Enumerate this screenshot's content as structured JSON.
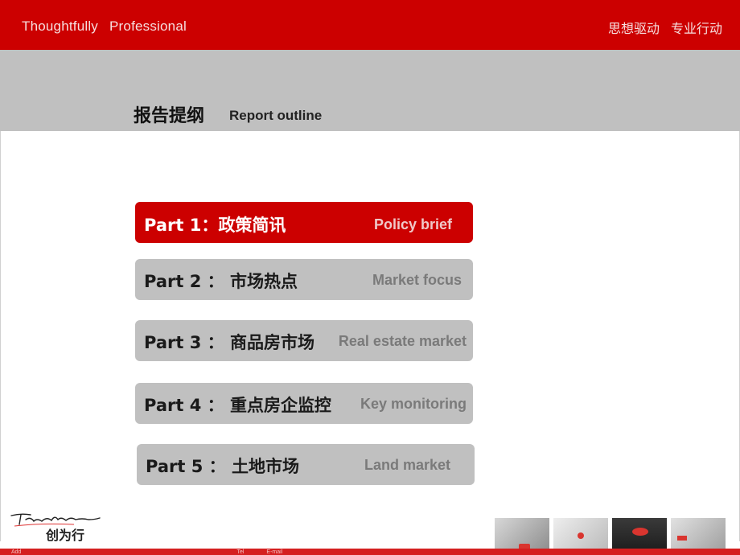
{
  "header": {
    "slogan_en": [
      "Thoughtfully",
      "Professional"
    ],
    "slogan_cn": [
      "思想驱动",
      "专业行动"
    ]
  },
  "section": {
    "title_cn": "报告提纲",
    "title_en": "Report outline"
  },
  "outline": [
    {
      "label_cn": "Part 1：政策简讯",
      "label_en": "Policy brief",
      "active": true
    },
    {
      "label_cn": "Part 2 ： 市场热点",
      "label_en": "Market focus",
      "active": false
    },
    {
      "label_cn": "Part 3 ： 商品房市场",
      "label_en": "Real estate market",
      "active": false
    },
    {
      "label_cn": "Part 4 ： 重点房企监控",
      "label_en": "Key monitoring",
      "active": false
    },
    {
      "label_cn": "Part 5 ： 土地市场",
      "label_en": "Land market",
      "active": false
    }
  ],
  "logo": {
    "script_text": "Trendline",
    "cn_text": "创为行"
  },
  "footer": {
    "address_label": "Add",
    "tel_label": "Tel",
    "email_label": "E-mail"
  },
  "colors": {
    "brand_red": "#cc0000",
    "band_gray": "#c0c0c0"
  }
}
